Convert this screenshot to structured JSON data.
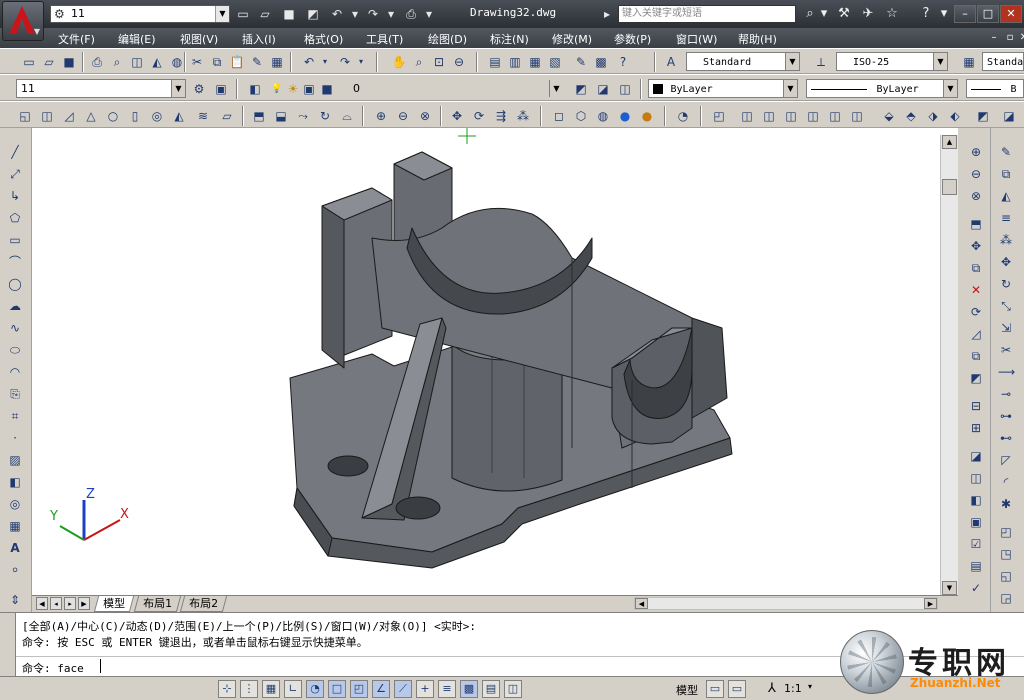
{
  "app": {
    "document_title": "Drawing32.dwg",
    "workspace": "11",
    "search_placeholder": "键入关键字或短语"
  },
  "menubar": {
    "items": [
      "文件(F)",
      "编辑(E)",
      "视图(V)",
      "插入(I)",
      "格式(O)",
      "工具(T)",
      "绘图(D)",
      "标注(N)",
      "修改(M)",
      "参数(P)",
      "窗口(W)",
      "帮助(H)"
    ]
  },
  "styles_toolbar": {
    "text_style": "Standard",
    "dim_style": "ISO-25",
    "table_style": "Standa"
  },
  "layers_toolbar": {
    "workspace_combo": "11",
    "layer": "0",
    "color": "ByLayer",
    "linetype": "ByLayer",
    "lineweight": "B"
  },
  "icons": {
    "app": "autocad-logo-icon",
    "workspace": "gear-icon",
    "new": "new-file-icon",
    "open": "open-folder-icon",
    "save": "save-icon",
    "undo": "undo-icon",
    "redo": "redo-icon",
    "print": "print-icon",
    "binoculars": "binoculars-icon",
    "tools": "tools-icon",
    "satellite": "satellite-icon",
    "star": "star-icon",
    "help": "help-icon"
  },
  "ucs": {
    "x_label": "X",
    "y_label": "Y",
    "z_label": "Z"
  },
  "layout_tabs": [
    "模型",
    "布局1",
    "布局2"
  ],
  "command": {
    "history_line1": "[全部(A)/中心(C)/动态(D)/范围(E)/上一个(P)/比例(S)/窗口(W)/对象(O)] <实时>:",
    "history_line2": "命令:  按 ESC 或 ENTER 键退出，或者单击鼠标右键显示快捷菜单。",
    "prompt": "命令: face"
  },
  "statusbar": {
    "model_label": "模型",
    "annotation_scale": "1:1"
  },
  "watermark": {
    "chinese": "专职网",
    "domain": "Zhuanzhi.Net"
  },
  "colors": {
    "titlebar": "#2b2f35",
    "model_face": "#6f7278",
    "model_edge": "#1a1a1a",
    "accent_red": "#c8141b",
    "watermark_orange": "#ff8a00"
  }
}
